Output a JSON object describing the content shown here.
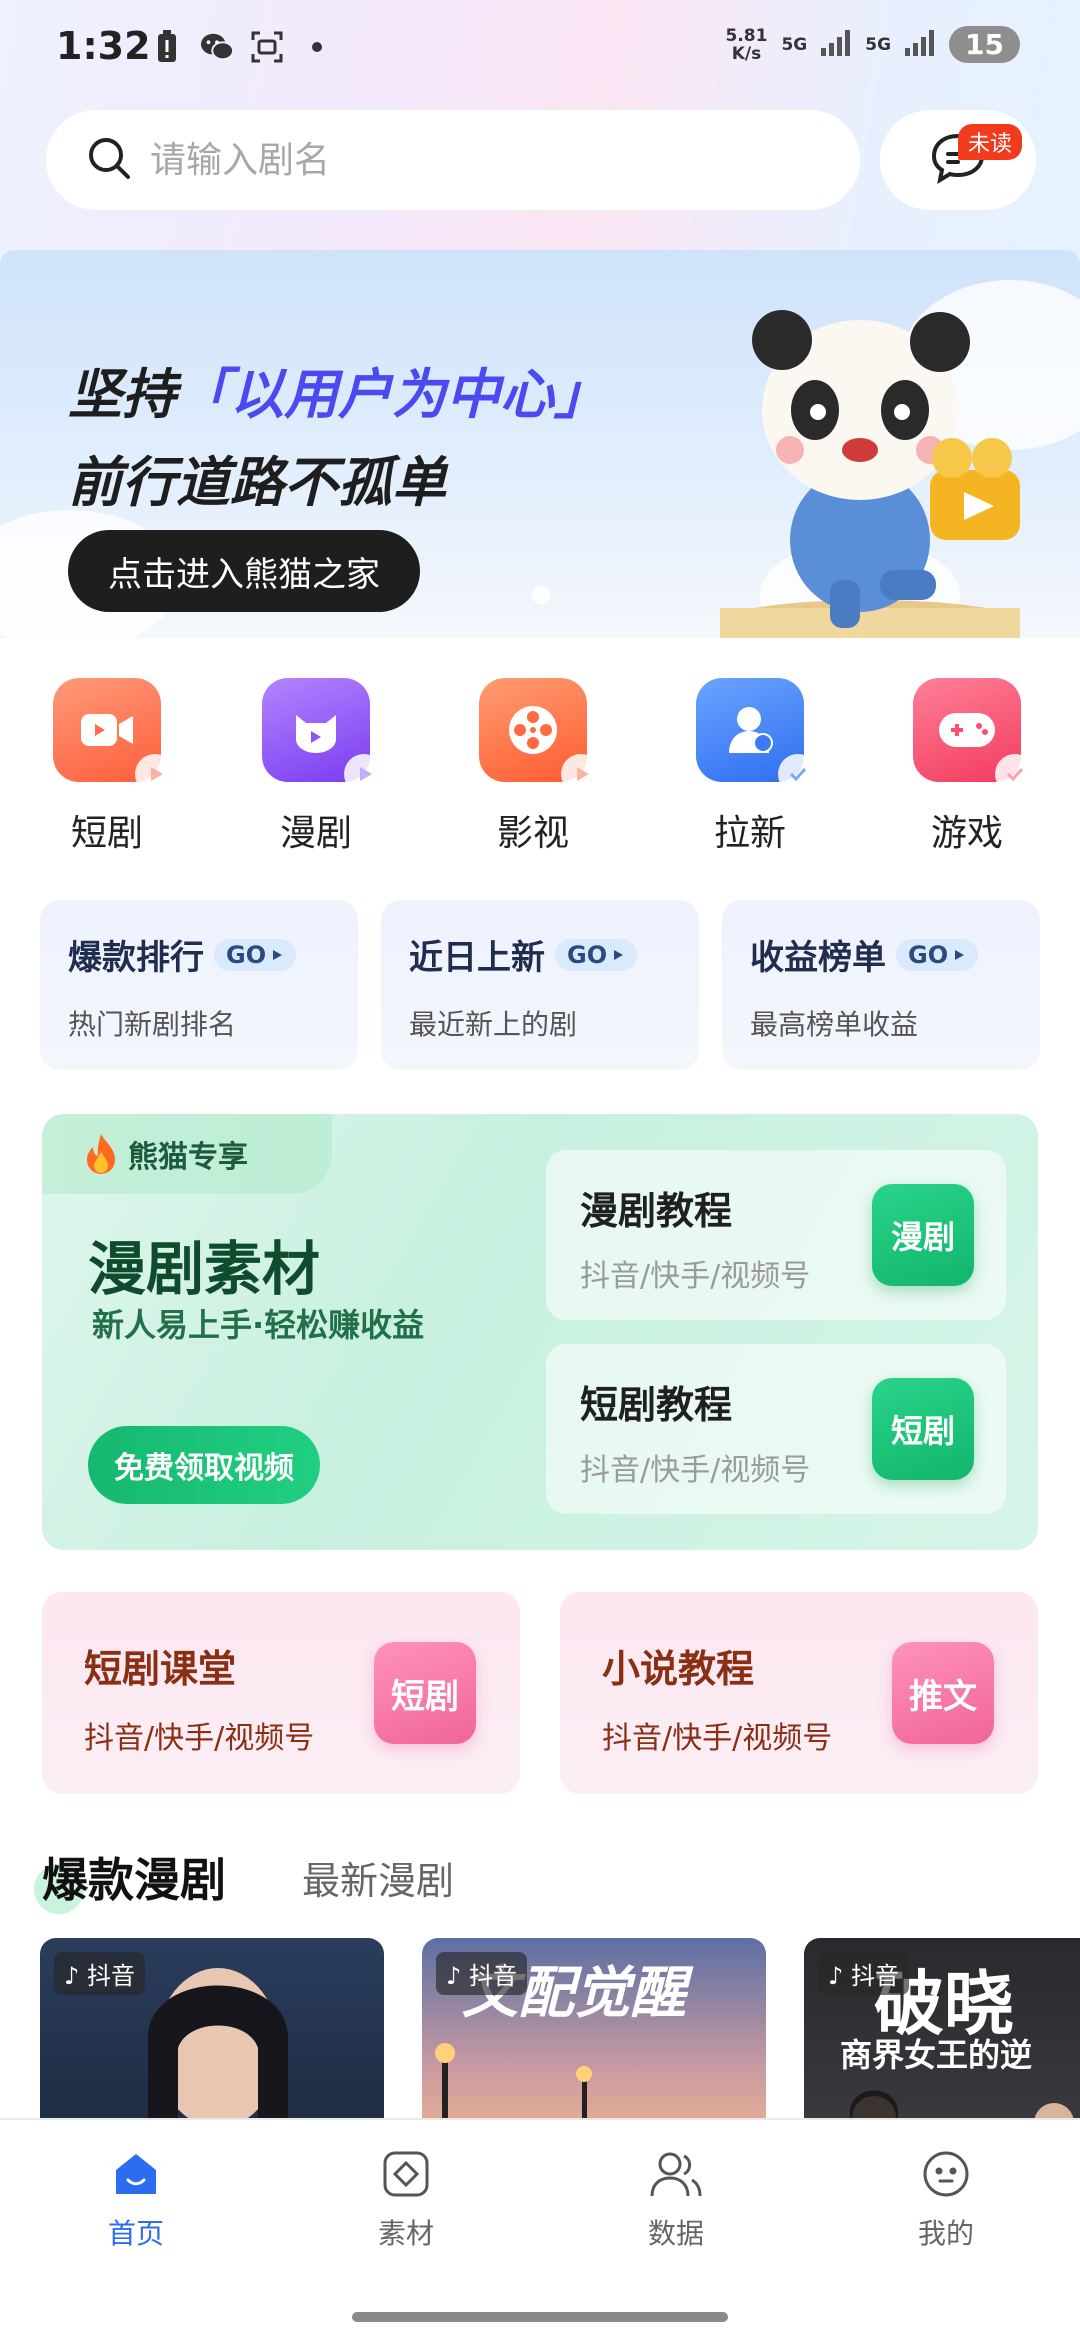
{
  "status_bar": {
    "time": "1:32",
    "speed_value": "5.81",
    "speed_unit": "K/s",
    "network1": "5G",
    "network2": "5G",
    "battery": "15"
  },
  "search": {
    "placeholder": "请输入剧名",
    "value": ""
  },
  "messages": {
    "unread_label": "未读"
  },
  "banner": {
    "line1_prefix": "坚持",
    "line1_highlight": "「以用户为中心」",
    "line2": "前行道路不孤单",
    "cta": "点击进入熊猫之家"
  },
  "categories": [
    {
      "label": "短剧",
      "icon": "video-camera-icon",
      "color": "#ff6a4d"
    },
    {
      "label": "漫剧",
      "icon": "cartoon-cat-icon",
      "color": "#8f55f5"
    },
    {
      "label": "影视",
      "icon": "film-reel-icon",
      "color": "#ff6a40"
    },
    {
      "label": "拉新",
      "icon": "invite-user-icon",
      "color": "#3a7cf6"
    },
    {
      "label": "游戏",
      "icon": "gamepad-icon",
      "color": "#ff4f6e"
    }
  ],
  "quick_cards": [
    {
      "title": "爆款排行",
      "go": "GO",
      "sub": "热门新剧排名"
    },
    {
      "title": "近日上新",
      "go": "GO",
      "sub": "最近新上的剧"
    },
    {
      "title": "收益榜单",
      "go": "GO",
      "sub": "最高榜单收益"
    }
  ],
  "panda_exclusive": {
    "tag": "熊猫专享",
    "title": "漫剧素材",
    "subtitle": "新人易上手·轻松赚收益",
    "button": "免费领取视频",
    "tutorials": [
      {
        "title": "漫剧教程",
        "sub": "抖音/快手/视频号",
        "tag": "漫剧"
      },
      {
        "title": "短剧教程",
        "sub": "抖音/快手/视频号",
        "tag": "短剧"
      }
    ]
  },
  "pink_cards": [
    {
      "title": "短剧课堂",
      "sub": "抖音/快手/视频号",
      "tag": "短剧"
    },
    {
      "title": "小说教程",
      "sub": "抖音/快手/视频号",
      "tag": "推文"
    }
  ],
  "drama_tabs": {
    "active": "爆款漫剧",
    "inactive": "最新漫剧"
  },
  "posters": [
    {
      "platform": "抖音",
      "title": ""
    },
    {
      "platform": "抖音",
      "title": "文配觉醒"
    },
    {
      "platform": "抖音",
      "title": "破晓",
      "subtitle": "商界女王的逆"
    }
  ],
  "bottom_nav": [
    {
      "label": "首页",
      "icon": "home-icon",
      "active": true
    },
    {
      "label": "素材",
      "icon": "material-icon",
      "active": false
    },
    {
      "label": "数据",
      "icon": "data-users-icon",
      "active": false
    },
    {
      "label": "我的",
      "icon": "profile-face-icon",
      "active": false
    }
  ],
  "colors": {
    "accent_blue": "#2c6cf0",
    "green": "#15b86f",
    "pink": "#f0649a"
  }
}
